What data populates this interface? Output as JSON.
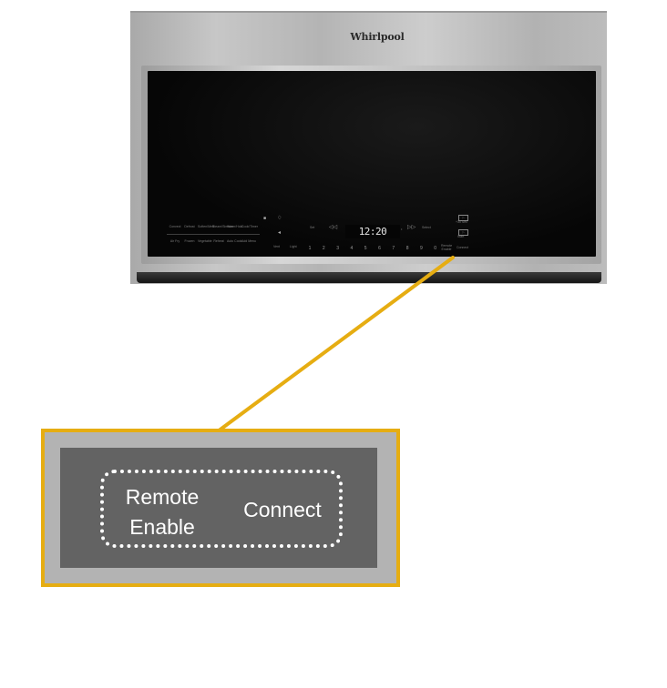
{
  "appliance": {
    "brand": "Whirlpool",
    "clock_display": "12:20",
    "cook_buttons_row1": [
      "Convect",
      "Defrost",
      "Soften/Melt",
      "Steam/Simmer",
      "Warm/Hold",
      "Cook/Timer"
    ],
    "cook_buttons_row2": [
      "Air Fry",
      "Frozen",
      "Vegetable",
      "Reheat",
      "Auto Cook",
      "Add Menu"
    ],
    "mid_labels": [
      "Set",
      "Cancel",
      "Select"
    ],
    "right_labels": [
      "+30 Sec",
      "Start"
    ],
    "number_keys": [
      "1",
      "2",
      "3",
      "4",
      "5",
      "6",
      "7",
      "8",
      "9",
      "0"
    ],
    "small_keys": [
      "Vent",
      "Light",
      "Remote Enable",
      "Connect"
    ]
  },
  "callout": {
    "remote_enable": "Remote\nEnable",
    "connect": "Connect",
    "accent_color": "#e6ad12"
  }
}
